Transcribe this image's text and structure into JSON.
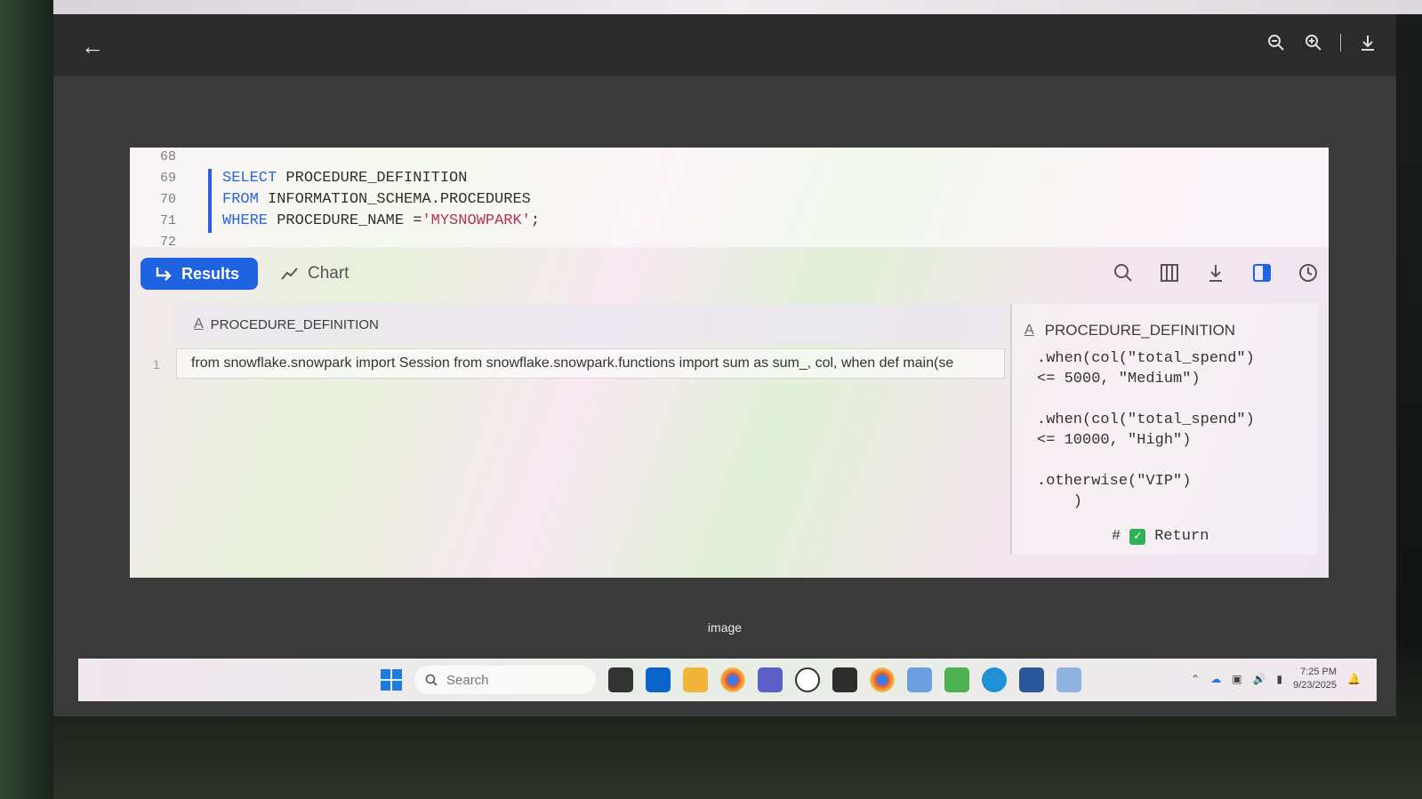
{
  "viewer": {
    "caption": "image"
  },
  "editor": {
    "lines": [
      {
        "num": "68",
        "text": ""
      },
      {
        "num": "69",
        "kw": "SELECT",
        "rest": " PROCEDURE_DEFINITION"
      },
      {
        "num": "70",
        "kw": "FROM",
        "rest": " INFORMATION_SCHEMA.PROCEDURES"
      },
      {
        "num": "71",
        "kw": "WHERE",
        "rest": " PROCEDURE_NAME =",
        "str": "'MYSNOWPARK'",
        "tail": ";"
      },
      {
        "num": "72",
        "text": ""
      }
    ]
  },
  "toolbar": {
    "results_label": "Results",
    "chart_label": "Chart"
  },
  "grid": {
    "column_header": "PROCEDURE_DEFINITION",
    "row_number": "1",
    "cell_value": "from snowflake.snowpark import Session from snowflake.snowpark.functions import sum as sum_, col, when def main(se"
  },
  "side_panel": {
    "title": "PROCEDURE_DEFINITION",
    "code": ".when(col(\"total_spend\")\n<= 5000, \"Medium\")\n\n.when(col(\"total_spend\")\n<= 10000, \"High\")\n\n.otherwise(\"VIP\")\n    )",
    "return_prefix": "#",
    "return_label": "Return"
  },
  "taskbar": {
    "search_placeholder": "Search",
    "time": "7:25 PM",
    "date": "9/23/2025"
  },
  "colors": {
    "accent": "#1f63e0",
    "keyword": "#2a66d8",
    "string": "#b5334f"
  }
}
